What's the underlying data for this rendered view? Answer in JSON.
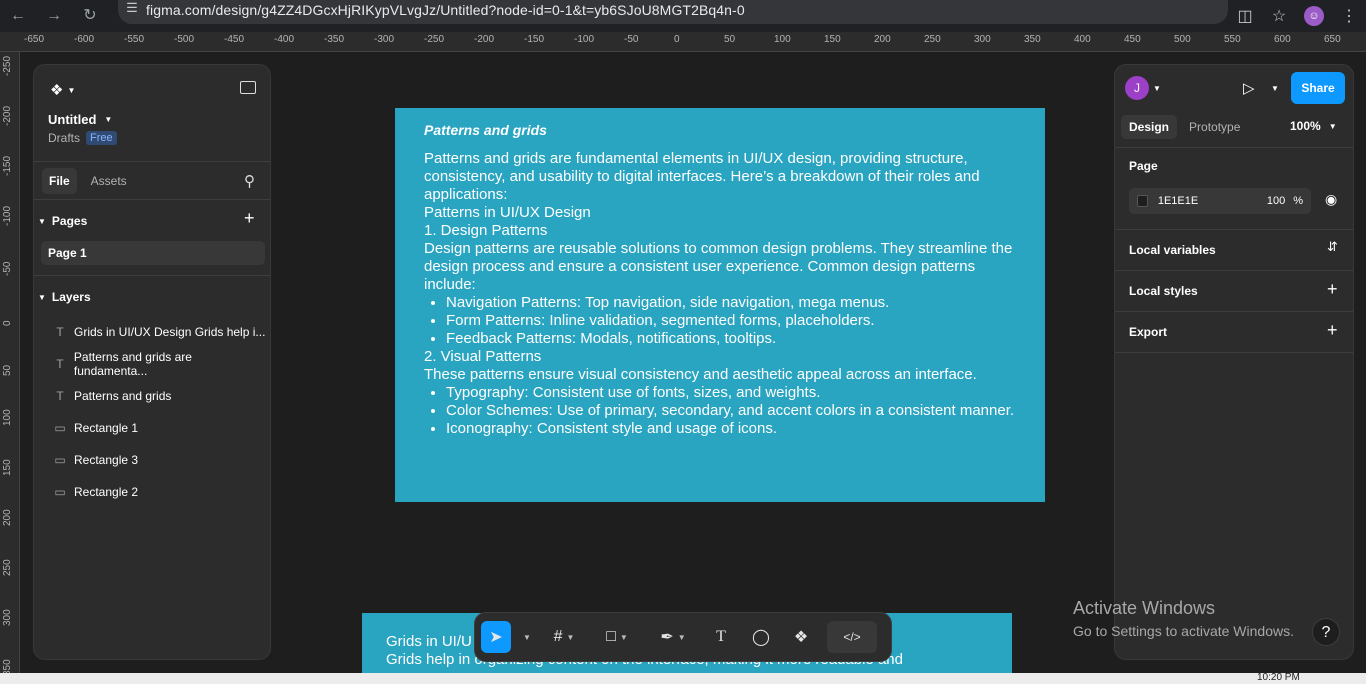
{
  "browser": {
    "url": "figma.com/design/g4ZZ4DGcxHjRIKypVLvgJz/Untitled?node-id=0-1&t=yb6SJoU8MGT2Bq4n-0",
    "profile_initial": "☺"
  },
  "ruler": {
    "top": [
      "-650",
      "-600",
      "-550",
      "-500",
      "-450",
      "-400",
      "-350",
      "-300",
      "-250",
      "-200",
      "-150",
      "-100",
      "-50",
      "0",
      "50",
      "100",
      "150",
      "200",
      "250",
      "300",
      "350",
      "400",
      "450",
      "500",
      "550",
      "600",
      "650"
    ],
    "left": [
      "-250",
      "-200",
      "-150",
      "-100",
      "-50",
      "0",
      "50",
      "100",
      "150",
      "200",
      "250",
      "300",
      "350"
    ]
  },
  "left_panel": {
    "file_name": "Untitled",
    "location": "Drafts",
    "plan_badge": "Free",
    "tabs": [
      "File",
      "Assets"
    ],
    "pages_title": "Pages",
    "pages": [
      "Page 1"
    ],
    "layers_title": "Layers",
    "layers": [
      {
        "type": "text",
        "name": "Grids in UI/UX Design Grids help i..."
      },
      {
        "type": "text",
        "name": "Patterns and grids are fundamenta..."
      },
      {
        "type": "text",
        "name": "Patterns and grids"
      },
      {
        "type": "rect",
        "name": "Rectangle 1"
      },
      {
        "type": "rect",
        "name": "Rectangle 3"
      },
      {
        "type": "rect",
        "name": "Rectangle 2"
      }
    ]
  },
  "canvas": {
    "title": "Patterns and grids",
    "intro": "Patterns and grids are fundamental elements in UI/UX design, providing structure, consistency, and usability to digital interfaces. Here’s a breakdown of their roles and applications:",
    "heading1": "Patterns in UI/UX Design",
    "sub1": "1. Design Patterns",
    "sub1_text": "Design patterns are reusable solutions to common design problems. They streamline the design process and ensure a consistent user experience. Common design patterns include:",
    "list1": [
      "Navigation Patterns: Top navigation, side navigation, mega menus.",
      "Form Patterns: Inline validation, segmented forms, placeholders.",
      "Feedback Patterns: Modals, notifications, tooltips."
    ],
    "sub2": "2. Visual Patterns",
    "sub2_text": "These patterns ensure visual consistency and aesthetic appeal across an interface.",
    "list2": [
      "Typography: Consistent use of fonts, sizes, and weights.",
      "Color Schemes: Use of primary, secondary, and accent colors in a consistent manner.",
      "Iconography: Consistent style and usage of icons."
    ],
    "frame2_line1": "Grids in UI/U",
    "frame2_line2": "Grids help in organizing content on the interface, making it more readable and"
  },
  "right_panel": {
    "avatar": "J",
    "share_label": "Share",
    "tabs": [
      "Design",
      "Prototype"
    ],
    "zoom": "100%",
    "page_title": "Page",
    "page_color": "1E1E1E",
    "page_opacity": "100",
    "percent": "%",
    "sections": [
      "Local variables",
      "Local styles",
      "Export"
    ]
  },
  "activate": {
    "title": "Activate Windows",
    "sub": "Go to Settings to activate Windows."
  },
  "taskbar": {
    "time": "10:20 PM"
  },
  "colors": {
    "frame": "#29a4c1",
    "accent": "#0d99ff",
    "bg": "#1e1e1e"
  }
}
